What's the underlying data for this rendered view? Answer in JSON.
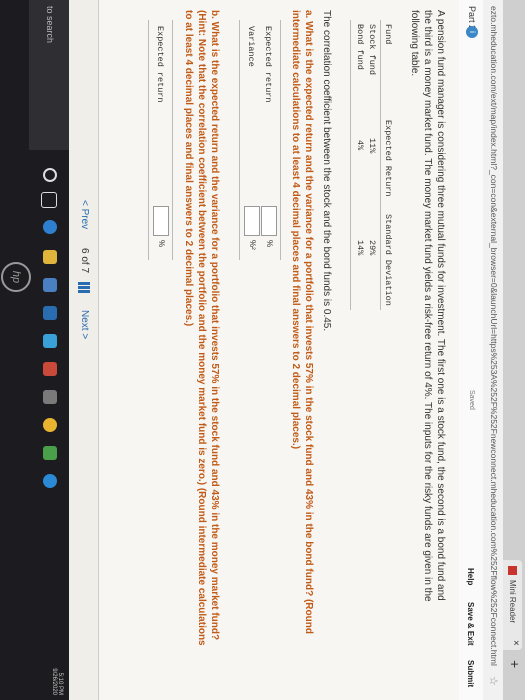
{
  "browser": {
    "tab_label": "Mini Reader",
    "tab_close": "×",
    "new_tab": "+",
    "url": "ezto.mheducation.com/ext/map/index.html?_con=con&external_browser=0&launchUrl=https%253A%252F%252Fnewconnect.mheducation.com%252Fflow%252Fconnect.html"
  },
  "header": {
    "part": "Part 2",
    "badge": "i",
    "saved": "Saved",
    "help": "Help",
    "save_exit": "Save & Exit",
    "submit": "Submit"
  },
  "question": {
    "intro_lines": [
      "A pension fund manager is considering three mutual funds for investment. The first one is a stock fund, the second is a bond fund and",
      "the third is a money market fund. The money market fund yields a risk-free return of 4%. The inputs for the risky funds are given in the",
      "following table."
    ],
    "table": {
      "headers": [
        "Fund",
        "Expected Return",
        "Standard Deviation"
      ],
      "rows": [
        [
          "Stock fund",
          "11%",
          "29%"
        ],
        [
          "Bond fund",
          "4%",
          "14%"
        ]
      ]
    },
    "correlation": "The correlation coefficient between the stock and the bond funds is 0.45.",
    "part_a": {
      "lines": [
        "a. What is the expected return and the variance for a portfolio that invests 57% in the stock fund and 43% in the bond fund? (Round",
        "intermediate calculations to at least 4 decimal places and final answers to 2 decimal places.)"
      ],
      "rows": [
        {
          "label": "Expected return",
          "value": "",
          "unit": "%"
        },
        {
          "label": "Variance",
          "value": "",
          "unit": "%²"
        }
      ]
    },
    "part_b": {
      "lines": [
        "b. What is the expected return and the variance for a portfolio that invests 57% in the stock fund and 43% in the money market fund?",
        "(Hint: Note that the correlation coefficient between the portfolio and the money market fund is zero.) (Round intermediate calculations",
        "to at least 4 decimal places and final answers to 2 decimal places.)"
      ],
      "rows": [
        {
          "label": "Expected return",
          "value": "",
          "unit": "%"
        }
      ]
    }
  },
  "nav": {
    "prev": "< Prev",
    "page": "6 of 7",
    "next": "Next >"
  },
  "taskbar": {
    "search": "to search",
    "clock": "5:10 PM",
    "date": "9/26/2020",
    "brand": "hp"
  }
}
